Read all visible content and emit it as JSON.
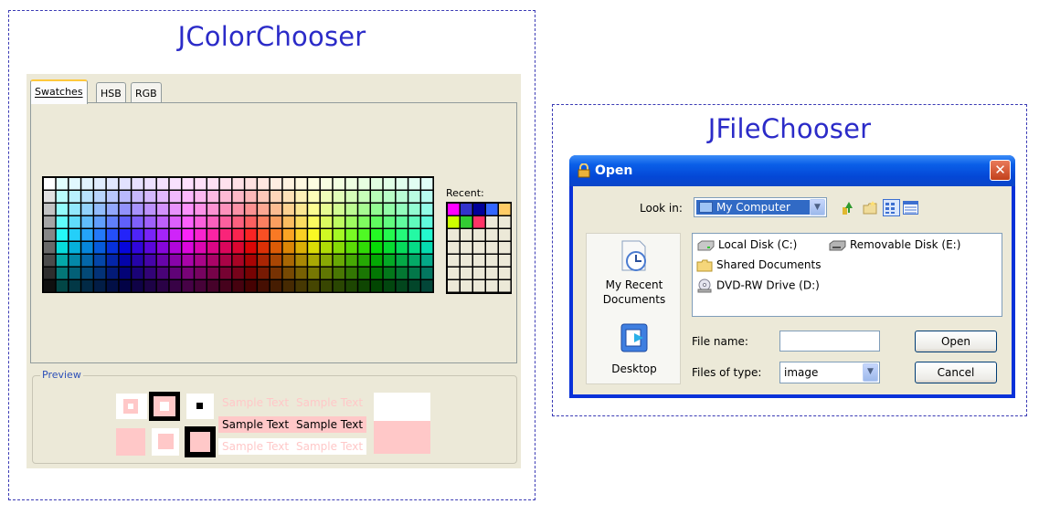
{
  "color_chooser": {
    "title": "JColorChooser",
    "tabs": [
      {
        "label": "Swatches",
        "active": true
      },
      {
        "label": "HSB",
        "active": false
      },
      {
        "label": "RGB",
        "active": false
      }
    ],
    "recent_label": "Recent:",
    "recent_colors": [
      "#ff00ff",
      "#3333cc",
      "#000099",
      "#3366ff",
      "#ffcc66",
      "#ccff00",
      "#33cc33",
      "#ff3366"
    ],
    "preview": {
      "label": "Preview",
      "sample_text": "Sample Text",
      "accent_color": "#ffc8c8"
    }
  },
  "file_chooser": {
    "title": "JFileChooser",
    "dialog_title": "Open",
    "look_in_label": "Look in:",
    "look_in_value": "My Computer",
    "places": [
      {
        "label_line1": "My Recent",
        "label_line2": "Documents",
        "icon": "recent-documents-icon"
      },
      {
        "label_line1": "Desktop",
        "label_line2": "",
        "icon": "desktop-icon"
      }
    ],
    "files": [
      {
        "name": "Local Disk (C:)",
        "icon": "hard-drive-icon"
      },
      {
        "name": "Removable Disk (E:)",
        "icon": "removable-drive-icon"
      },
      {
        "name": "Shared Documents",
        "icon": "folder-icon"
      },
      {
        "name": "DVD-RW Drive (D:)",
        "icon": "dvd-drive-icon"
      }
    ],
    "file_name_label": "File name:",
    "file_name_value": "",
    "files_of_type_label": "Files of type:",
    "files_of_type_value": "image",
    "open_button": "Open",
    "cancel_button": "Cancel",
    "close_glyph": "✕"
  }
}
